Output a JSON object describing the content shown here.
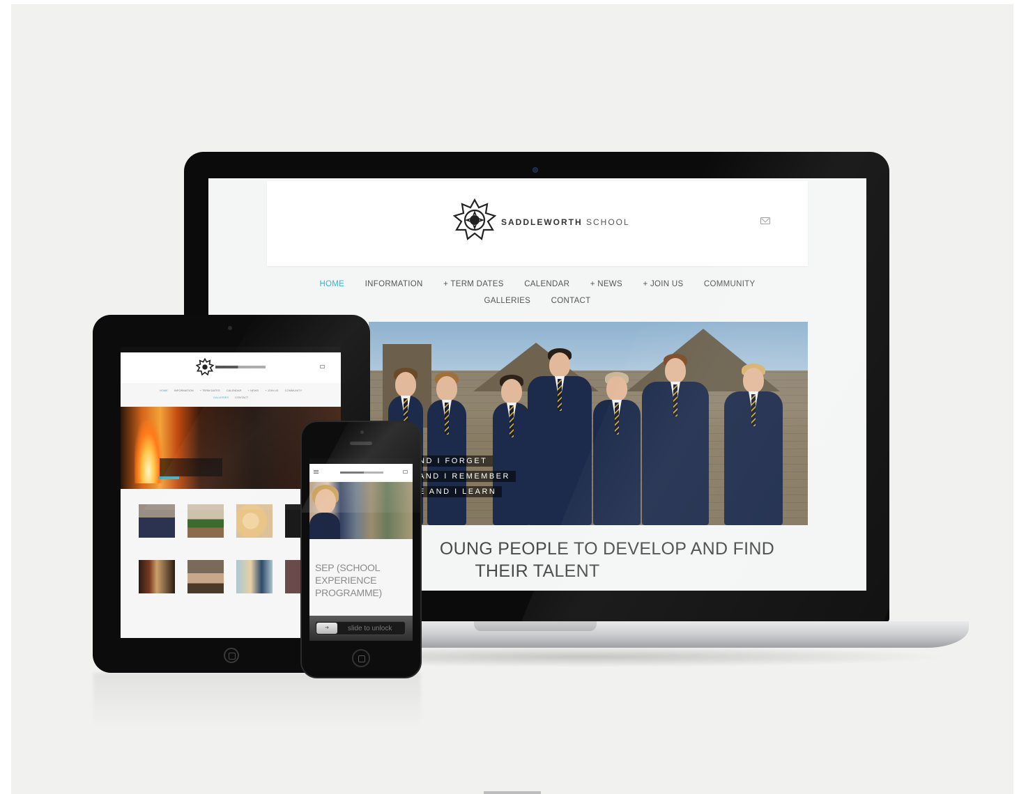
{
  "brand": {
    "name_bold": "SADDLEWORTH",
    "name_light": "SCHOOL"
  },
  "nav": {
    "row1": [
      {
        "label": "HOME",
        "active": true
      },
      {
        "label": "INFORMATION"
      },
      {
        "label": "+ TERM DATES"
      },
      {
        "label": "CALENDAR"
      },
      {
        "label": "+ NEWS"
      },
      {
        "label": "+ JOIN US"
      },
      {
        "label": "COMMUNITY"
      }
    ],
    "row2": [
      {
        "label": "GALLERIES"
      },
      {
        "label": "CONTACT"
      }
    ]
  },
  "hero": {
    "lines": [
      "ND I FORGET",
      "AND I REMEMBER",
      "E AND I LEARN"
    ]
  },
  "tagline": {
    "line1": "OUNG PEOPLE TO DEVELOP AND FIND",
    "line2": "THEIR TALENT"
  },
  "phone": {
    "card_title": "SEP (SCHOOL EXPERIENCE PROGRAMME)",
    "lock_label": "slide to unlock"
  },
  "colors": {
    "accent": "#3bb1d2",
    "background": "#f1f1f0",
    "uniform": "#1c2a4b"
  },
  "icons": [
    "mail-icon",
    "school-emblem-icon",
    "menu-icon",
    "home-button-icon"
  ]
}
